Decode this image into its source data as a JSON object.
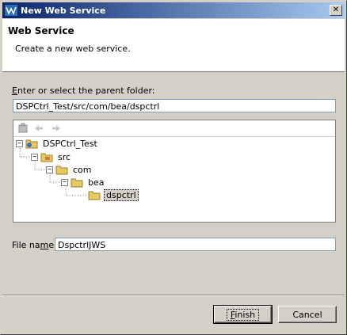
{
  "window": {
    "title": "New Web Service"
  },
  "banner": {
    "title": "Web Service",
    "description": "Create a new web service."
  },
  "folder": {
    "label_pre": "",
    "label_underline": "E",
    "label_post": "nter or select the parent folder:",
    "path_value": "DSPCtrl_Test/src/com/bea/dspctrl"
  },
  "tree": {
    "toolbar_icons": [
      "home-icon",
      "back-icon",
      "forward-icon"
    ],
    "nodes": [
      {
        "label": "DSPCtrl_Test",
        "icon": "project-icon",
        "expanded": true
      },
      {
        "label": "src",
        "icon": "source-folder-icon",
        "expanded": true
      },
      {
        "label": "com",
        "icon": "package-folder-icon",
        "expanded": true
      },
      {
        "label": "bea",
        "icon": "package-folder-icon",
        "expanded": true
      },
      {
        "label": "dspctrl",
        "icon": "package-folder-icon",
        "selected": true
      }
    ]
  },
  "file": {
    "label_pre": "File na",
    "label_underline": "m",
    "label_post": "e:",
    "value": "DspctrlJWS"
  },
  "buttons": {
    "finish_underline": "F",
    "finish_rest": "inish",
    "cancel": "Cancel"
  },
  "colors": {
    "title_gradient_start": "#0a246a",
    "title_gradient_end": "#a6caf0",
    "dialog_bg": "#d4d0c8"
  }
}
